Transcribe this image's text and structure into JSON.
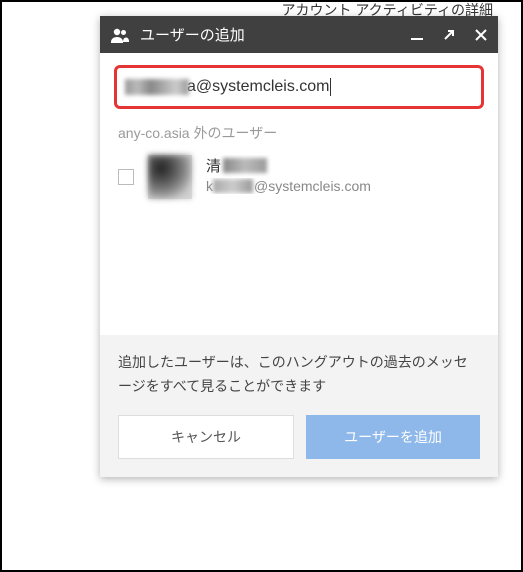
{
  "background": {
    "partial_link": "アカウント アクティビティの詳細"
  },
  "dialog": {
    "title": "ユーザーの追加",
    "input_value_suffix": "a@systemcleis.com",
    "section_label": "any-co.asia 外のユーザー",
    "user": {
      "name_prefix": "清",
      "email_visible_suffix": "@systemcleis.com"
    },
    "footer_note": "追加したユーザーは、このハングアウトの過去のメッセージをすべて見ることができます",
    "cancel_label": "キャンセル",
    "add_label": "ユーザーを追加"
  }
}
